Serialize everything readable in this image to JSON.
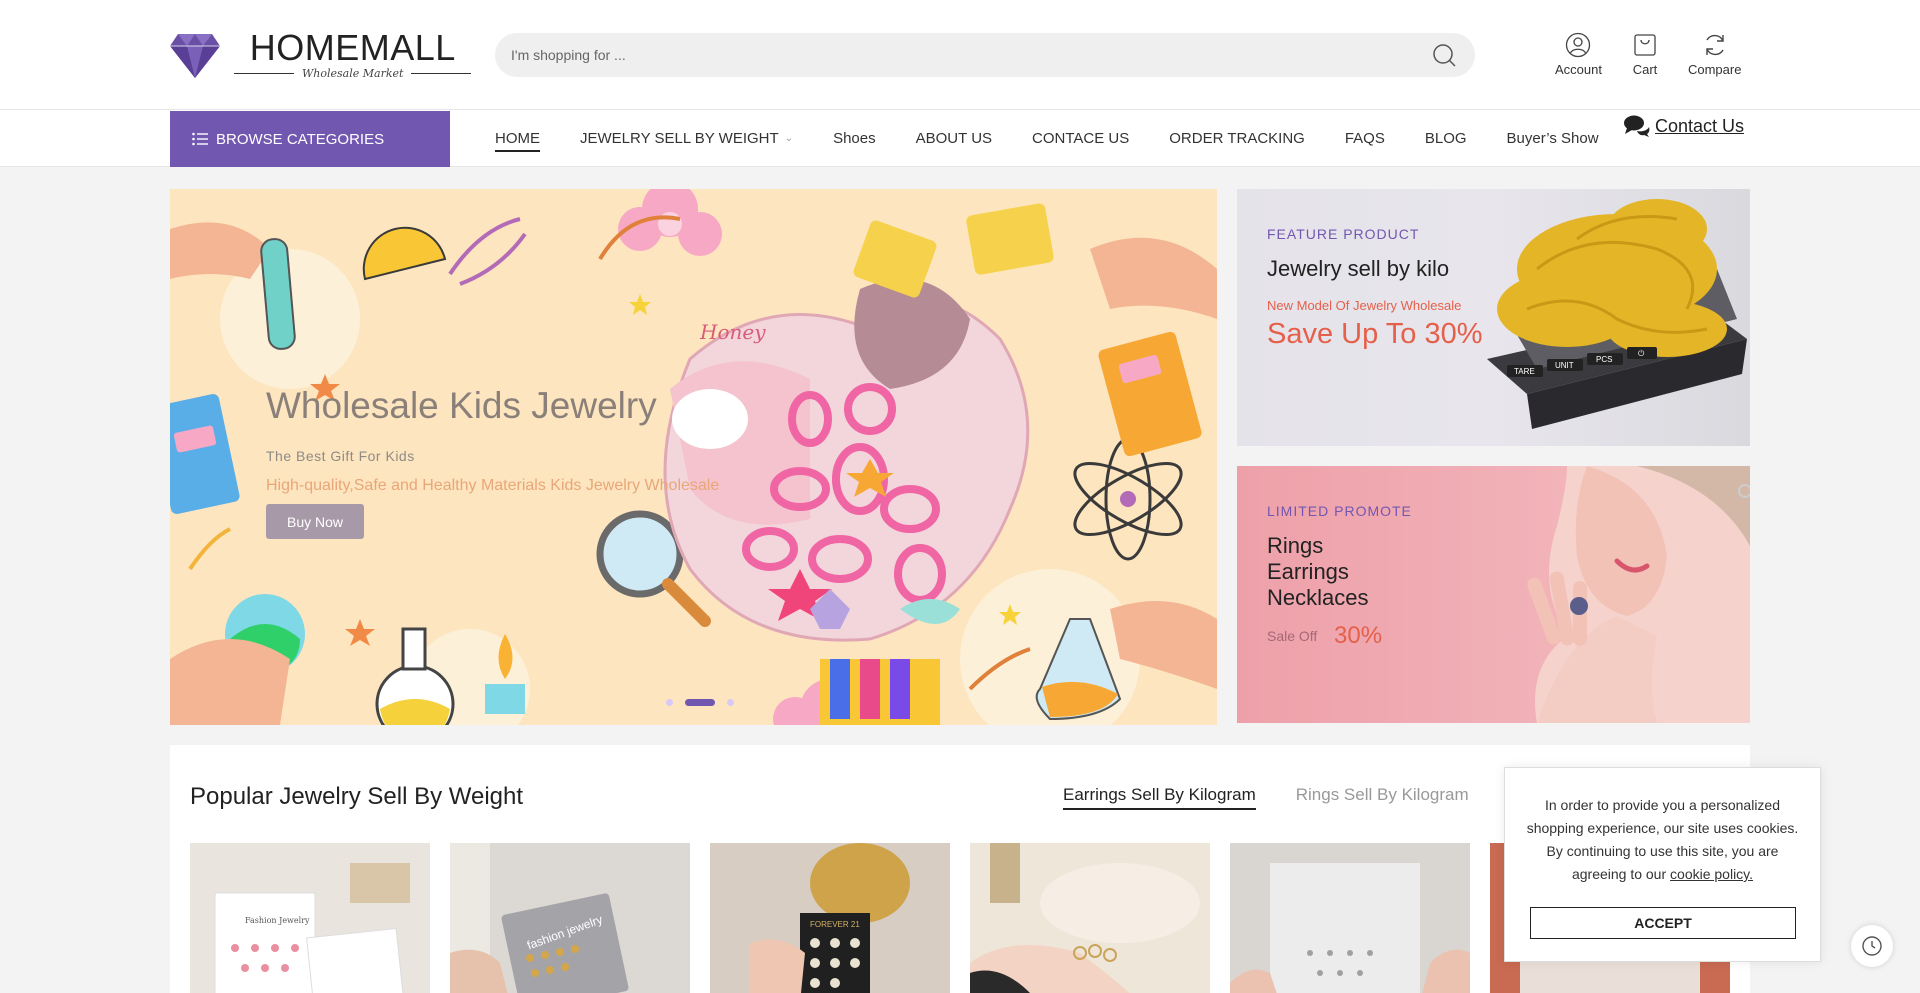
{
  "brand": {
    "name": "HOMEMALL",
    "tagline": "Wholesale Market",
    "logo_icon": "diamond-icon",
    "accent_color": "#7257b0"
  },
  "search": {
    "placeholder": "I'm shopping for ...",
    "icon": "search-icon"
  },
  "header_icons": [
    {
      "label": "Account",
      "icon": "user-icon"
    },
    {
      "label": "Cart",
      "icon": "cart-icon"
    },
    {
      "label": "Compare",
      "icon": "refresh-icon"
    }
  ],
  "nav": {
    "browse_label": "BROWSE CATEGORIES",
    "items": [
      {
        "label": "HOME",
        "active": true
      },
      {
        "label": "JEWELRY SELL BY WEIGHT",
        "dropdown": true
      },
      {
        "label": "Shoes"
      },
      {
        "label": "ABOUT US"
      },
      {
        "label": "CONTACE US"
      },
      {
        "label": "ORDER TRACKING"
      },
      {
        "label": "FAQS"
      },
      {
        "label": "BLOG"
      },
      {
        "label": "Buyer’s Show"
      }
    ],
    "contact_label": "Contact Us"
  },
  "hero": {
    "title": "Wholesale Kids Jewelry",
    "subtitle": "The Best Gift For Kids",
    "description": "High-quality,Safe and Healthy Materials Kids Jewelry Wholesale",
    "button": "Buy Now",
    "box_text": "Honey",
    "slides": 3,
    "active_slide": 2
  },
  "banners": [
    {
      "tag": "FEATURE PRODUCT",
      "title": "Jewelry sell by kilo",
      "subtitle": "New Model Of Jewelry Wholesale",
      "highlight": "Save Up To 30%",
      "scale_buttons": [
        "TARE",
        "UNIT",
        "PCS",
        "⏻"
      ]
    },
    {
      "tag": "LIMITED PROMOTE",
      "lines": [
        "Rings",
        "Earrings",
        "Necklaces"
      ],
      "sale_label": "Sale Off",
      "sale_value": "30%"
    }
  ],
  "popular": {
    "title": "Popular Jewelry Sell By Weight",
    "tabs": [
      {
        "label": "Earrings Sell By Kilogram",
        "active": true
      },
      {
        "label": "Rings Sell By Kilogram",
        "active": false
      }
    ],
    "products": [
      {
        "card_text": "Fashion Jewelry"
      },
      {
        "card_text": "fashion jewelry"
      },
      {
        "card_text": "FOREVER 21"
      },
      {
        "card_text": ""
      },
      {
        "card_text": ""
      },
      {
        "card_text": ""
      }
    ]
  },
  "cookie": {
    "text": "In order to provide you a personalized shopping experience, our site uses cookies. By continuing to use this site, you are agreeing to our",
    "link": "cookie policy.",
    "button": "ACCEPT"
  }
}
